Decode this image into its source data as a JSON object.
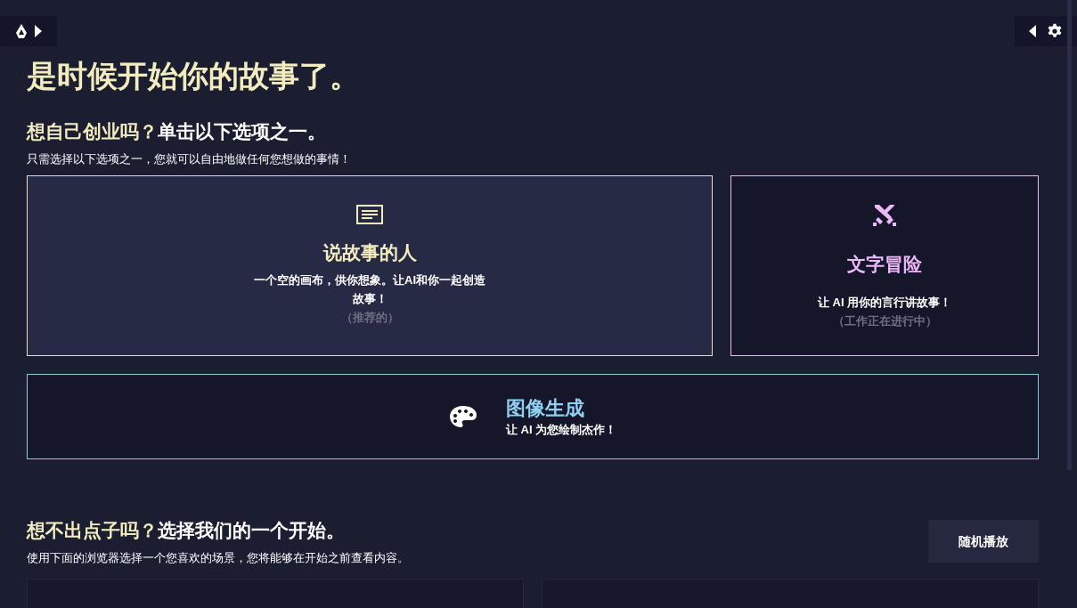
{
  "top_left_buttons": [
    {
      "kind": "logo"
    },
    {
      "kind": "expand"
    }
  ],
  "top_right_buttons": [
    {
      "kind": "collapse"
    },
    {
      "kind": "settings"
    }
  ],
  "title": "是时候开始你的故事了。",
  "section_1": {
    "heading_accent": "想自己创业吗？",
    "heading_rest": "单击以下选项之一。",
    "description": "只需选择以下选项之一，您就可以自由地做任何您想做的事情！"
  },
  "modes": [
    {
      "kind": "storyteller",
      "title": "说故事的人",
      "description": "一个空的画布，供你想象。让AI和你一起创造故事！",
      "note": "（推荐的）"
    },
    {
      "kind": "adventure",
      "title": "文字冒险",
      "description": "让 AI 用你的言行讲故事！",
      "note": "（工作正在进行中）"
    },
    {
      "kind": "image",
      "title": "图像生成",
      "description": "让 AI 为您绘制杰作！"
    }
  ],
  "section_2": {
    "heading_accent": "想不出点子吗？",
    "heading_rest": "选择我们的一个开始。",
    "description": "使用下面的浏览器选择一个您喜欢的场景，您将能够在开始之前查看内容。",
    "shuffle_button": "随机播放"
  }
}
